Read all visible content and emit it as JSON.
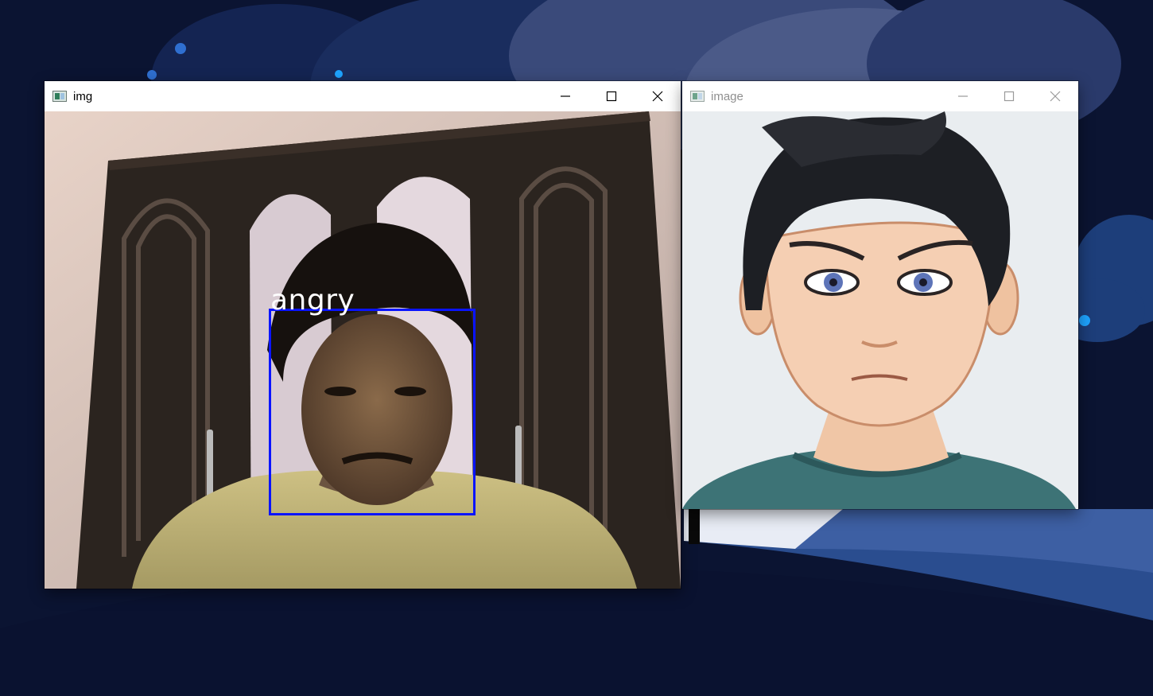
{
  "windows": {
    "camera": {
      "title": "img",
      "detection": {
        "label": "angry"
      }
    },
    "avatar": {
      "title": "image"
    }
  },
  "icons": {
    "app": "opencv-window-icon",
    "minimize": "minimize-icon",
    "maximize": "maximize-icon",
    "close": "close-icon"
  },
  "colors": {
    "desktop_bg": "#0a1230",
    "face_box": "#0a14ff",
    "avatar_bg": "#e9edf0",
    "avatar_shirt": "#3d7376"
  }
}
